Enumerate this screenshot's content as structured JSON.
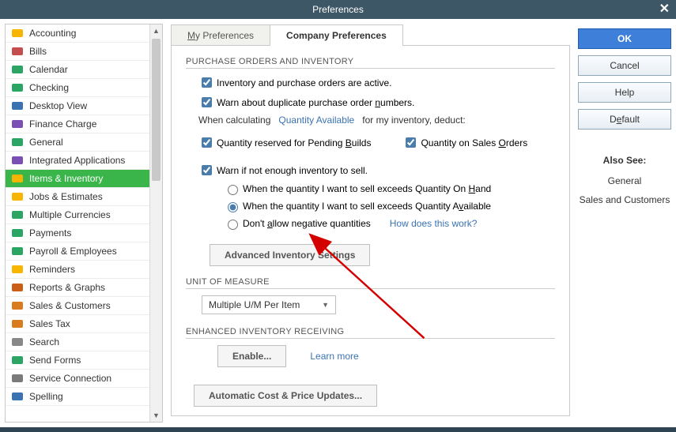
{
  "window": {
    "title": "Preferences",
    "close_tooltip": "Close"
  },
  "sidebar": {
    "items": [
      {
        "label": "Accounting",
        "icon_color": "#f7b500"
      },
      {
        "label": "Bills",
        "icon_color": "#c44d4d"
      },
      {
        "label": "Calendar",
        "icon_color": "#2aa564"
      },
      {
        "label": "Checking",
        "icon_color": "#2aa564"
      },
      {
        "label": "Desktop View",
        "icon_color": "#3a73b3"
      },
      {
        "label": "Finance Charge",
        "icon_color": "#7a4fb3"
      },
      {
        "label": "General",
        "icon_color": "#2aa564"
      },
      {
        "label": "Integrated Applications",
        "icon_color": "#7a4fb3"
      },
      {
        "label": "Items & Inventory",
        "icon_color": "#f7b500"
      },
      {
        "label": "Jobs & Estimates",
        "icon_color": "#f7b500"
      },
      {
        "label": "Multiple Currencies",
        "icon_color": "#2aa564"
      },
      {
        "label": "Payments",
        "icon_color": "#2aa564"
      },
      {
        "label": "Payroll & Employees",
        "icon_color": "#2aa564"
      },
      {
        "label": "Reminders",
        "icon_color": "#f7b500"
      },
      {
        "label": "Reports & Graphs",
        "icon_color": "#c95e17"
      },
      {
        "label": "Sales & Customers",
        "icon_color": "#d97b1f"
      },
      {
        "label": "Sales Tax",
        "icon_color": "#d97b1f"
      },
      {
        "label": "Search",
        "icon_color": "#888"
      },
      {
        "label": "Send Forms",
        "icon_color": "#2aa564"
      },
      {
        "label": "Service Connection",
        "icon_color": "#7a7a7a"
      },
      {
        "label": "Spelling",
        "icon_color": "#3a73b3"
      }
    ],
    "active_index": 8
  },
  "tabs": {
    "inactive_key": "M",
    "inactive_rest": "y Preferences",
    "active_label": "Company Preferences"
  },
  "company_prefs": {
    "section1_title": "PURCHASE ORDERS AND INVENTORY",
    "cb_inv_active": "Inventory and purchase orders are active.",
    "cb_dup_po_pre": "Warn about duplicate purchase order ",
    "cb_dup_po_u": "n",
    "cb_dup_po_post": "umbers.",
    "when_calc_pre": "When calculating",
    "when_calc_link": "Quantity Available",
    "when_calc_post": "for my inventory, deduct:",
    "cb_qty_builds_pre": "Quantity reserved for Pending ",
    "cb_qty_builds_u": "B",
    "cb_qty_builds_post": "uilds",
    "cb_qty_orders_pre": "Quantity on Sales ",
    "cb_qty_orders_u": "O",
    "cb_qty_orders_post": "rders",
    "cb_warn_not_enough": "Warn if not enough inventory to sell.",
    "rb_qoh_pre": "When the quantity I want to sell exceeds Quantity On ",
    "rb_qoh_u": "H",
    "rb_qoh_post": "and",
    "rb_qa_pre": "When the quantity I want to sell exceeds Quantity A",
    "rb_qa_u": "v",
    "rb_qa_post": "ailable",
    "rb_neg_pre": "Don't ",
    "rb_neg_u": "a",
    "rb_neg_post": "llow negative quantities",
    "how_link": "How does this work?",
    "adv_btn": "Advanced Inventory Settings",
    "section2_title": "UNIT OF MEASURE",
    "uom_selected": "Multiple U/M Per Item",
    "section3_title": "ENHANCED INVENTORY RECEIVING",
    "enable_btn": "Enable...",
    "learn_more": "Learn more",
    "auto_cost_btn": "Automatic Cost & Price Updates..."
  },
  "right": {
    "ok": "OK",
    "cancel": "Cancel",
    "help": "Help",
    "default_pre": "D",
    "default_u": "e",
    "default_post": "fault",
    "also_see_title": "Also See:",
    "also1": "General",
    "also2": "Sales and Customers"
  }
}
